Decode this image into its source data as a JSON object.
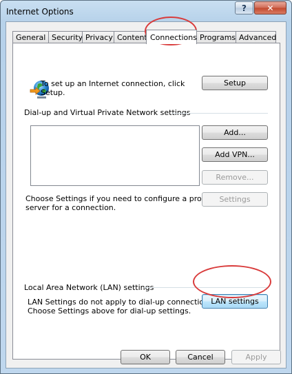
{
  "window": {
    "title": "Internet Options",
    "help_glyph": "?",
    "close_glyph": "✕"
  },
  "tabs": [
    {
      "label": "General"
    },
    {
      "label": "Security"
    },
    {
      "label": "Privacy"
    },
    {
      "label": "Content"
    },
    {
      "label": "Connections",
      "active": true
    },
    {
      "label": "Programs"
    },
    {
      "label": "Advanced"
    }
  ],
  "setup_section": {
    "icon": "network-globe-icon",
    "text_line1": "To set up an Internet connection, click",
    "text_line2": "Setup.",
    "setup_button": "Setup"
  },
  "dialup": {
    "group_label": "Dial-up and Virtual Private Network settings",
    "add_button": "Add...",
    "add_vpn_button": "Add VPN...",
    "remove_button": "Remove...",
    "settings_button": "Settings",
    "proxy_text_line1": "Choose Settings if you need to configure a proxy",
    "proxy_text_line2": "server for a connection."
  },
  "lan": {
    "group_label": "Local Area Network (LAN) settings",
    "text_line1": "LAN Settings do not apply to dial-up connections.",
    "text_line2": "Choose Settings above for dial-up settings.",
    "lan_button": "LAN settings"
  },
  "footer": {
    "ok_button": "OK",
    "cancel_button": "Cancel",
    "apply_button": "Apply"
  },
  "colors": {
    "annotation": "#d93b3b",
    "titlebar": "#b7d2ea"
  }
}
